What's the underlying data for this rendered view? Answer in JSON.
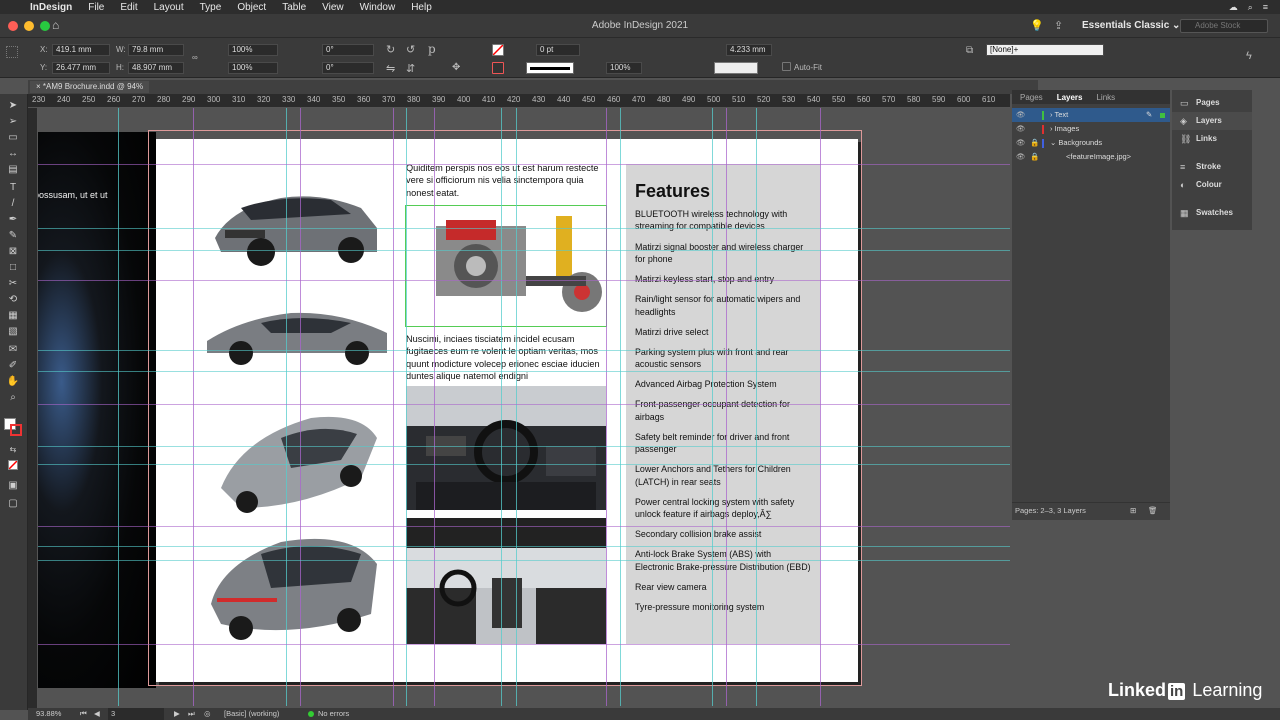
{
  "menubar": {
    "app": "InDesign",
    "items": [
      "File",
      "Edit",
      "Layout",
      "Type",
      "Object",
      "Table",
      "View",
      "Window",
      "Help"
    ]
  },
  "titlebar": {
    "title": "Adobe InDesign 2021",
    "workspace": "Essentials Classic",
    "search_placeholder": "Adobe Stock"
  },
  "control": {
    "x": "419.1 mm",
    "y": "26.477 mm",
    "w": "79.8 mm",
    "h": "48.907 mm",
    "scale_x": "100%",
    "scale_y": "100%",
    "rotate": "0°",
    "shear": "0°",
    "stroke_weight": "0 pt",
    "opacity": "100%",
    "gutter": "4.233 mm",
    "autofit": "Auto-Fit",
    "style": "[None]+"
  },
  "doc_tab": "*AM9 Brochure.indd @ 94%",
  "ruler_ticks": [
    "230",
    "240",
    "250",
    "260",
    "270",
    "280",
    "290",
    "300",
    "310",
    "320",
    "330",
    "340",
    "350",
    "360",
    "370",
    "380",
    "390",
    "400",
    "410",
    "420",
    "430",
    "440",
    "450",
    "460",
    "470",
    "480",
    "490",
    "500",
    "510",
    "520",
    "530",
    "540",
    "550",
    "560",
    "570",
    "580",
    "590",
    "600",
    "610"
  ],
  "left_page_text": "possusam, ut et ut",
  "text_frames": {
    "top": "Quiditem perspis nos eos ut est harum restecte vere si officiorum nis velia sinctempora quia nonest eatat.",
    "middle": "Nuscimi, inciaes tisciatem incidel ecusam fugitaeces eum re volent le optiam veritas, mos quunt modicture volecep erionec esciae iducien duntes alique natemol endigni"
  },
  "features": {
    "heading": "Features",
    "items": [
      "BLUETOOTH wireless technology with streaming for compatible devices",
      "Matirzi signal booster and wireless charger for phone",
      "Matirzi keyless start, stop and entry",
      "Rain/light sensor for automatic wipers and headlights",
      "Matirzi drive select",
      "Parking system plus with front and rear acoustic sensors",
      "Advanced Airbag Protection System",
      "Front-passenger occupant detection for airbags",
      "Safety belt reminder for driver and front passenger",
      "Lower Anchors and Tethers for Children (LATCH) in rear seats",
      "Power central locking system with safety unlock feature if airbags deploy,Â∑",
      "Secondary collision brake assist",
      "Anti-lock Brake System (ABS) with Electronic Brake-pressure Distribution (EBD)",
      "Rear view camera",
      "Tyre-pressure monitoring system"
    ]
  },
  "layers_panel": {
    "tabs": [
      "Pages",
      "Layers",
      "Links"
    ],
    "layers": [
      {
        "name": "Text",
        "color": "#40c040"
      },
      {
        "name": "Images",
        "color": "#e03030"
      },
      {
        "name": "Backgrounds",
        "color": "#4060e0"
      },
      {
        "name": "<featureImage.jpg>",
        "color": "#4060e0"
      }
    ],
    "footer": "Pages: 2–3, 3 Layers"
  },
  "side_panels": [
    "Pages",
    "Layers",
    "Links",
    "Stroke",
    "Colour",
    "Swatches"
  ],
  "status": {
    "zoom": "93.88%",
    "page": "3",
    "profile": "[Basic] (working)",
    "preflight": "No errors"
  },
  "brand": {
    "linked": "Linked",
    "in": "in",
    "learning": "Learning"
  }
}
